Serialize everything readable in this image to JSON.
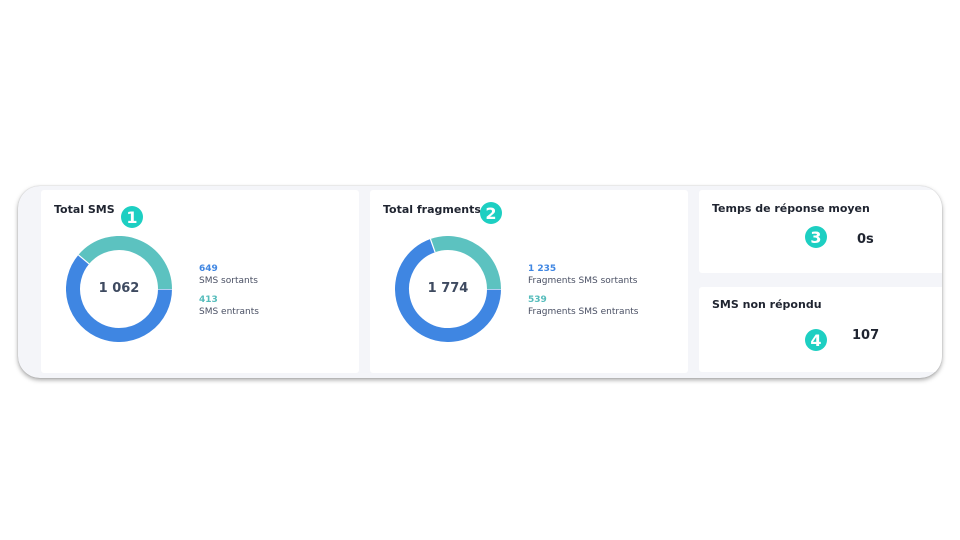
{
  "cards": {
    "total_sms": {
      "title": "Total SMS",
      "badge": "1",
      "total": "1 062",
      "outgoing_value": "649",
      "outgoing_label": "SMS sortants",
      "incoming_value": "413",
      "incoming_label": "SMS entrants"
    },
    "total_fragments": {
      "title": "Total fragments",
      "badge": "2",
      "total": "1 774",
      "outgoing_value": "1 235",
      "outgoing_label": "Fragments SMS sortants",
      "incoming_value": "539",
      "incoming_label": "Fragments SMS entrants"
    },
    "avg_response": {
      "title": "Temps de réponse moyen",
      "badge": "3",
      "value": "0s"
    },
    "unanswered": {
      "title": "SMS non répondu",
      "badge": "4",
      "value": "107"
    }
  },
  "chart_data": [
    {
      "type": "pie",
      "categories": [
        "SMS sortants",
        "SMS entrants"
      ],
      "values": [
        649,
        413
      ],
      "colors": [
        "#3f86e2",
        "#5cc2c0"
      ]
    },
    {
      "type": "pie",
      "categories": [
        "Fragments SMS sortants",
        "Fragments SMS entrants"
      ],
      "values": [
        1235,
        539
      ],
      "colors": [
        "#3f86e2",
        "#5cc2c0"
      ]
    }
  ]
}
